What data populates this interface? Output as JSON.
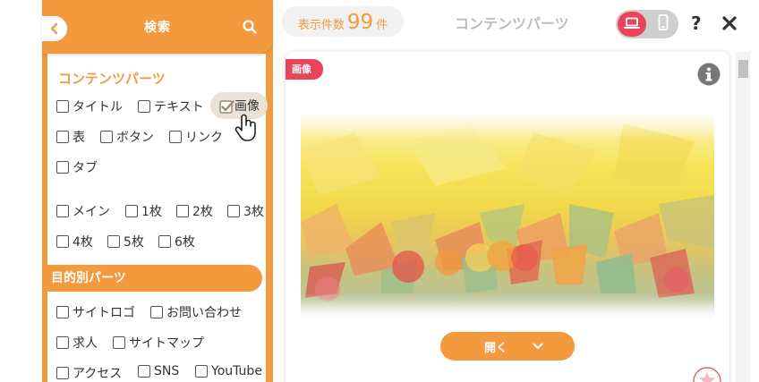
{
  "sidebar": {
    "title": "検索",
    "section1_title": "コンテンツパーツ",
    "section2_title": "目的別パーツ",
    "checkboxes": {
      "title": "タイトル",
      "text": "テキスト",
      "image": "画像",
      "table": "表",
      "button": "ボタン",
      "link": "リンク",
      "tab": "タブ",
      "main": "メイン",
      "one": "1枚",
      "two": "2枚",
      "three": "3枚",
      "four": "4枚",
      "five": "5枚",
      "six": "6枚",
      "sitelogo": "サイトロゴ",
      "contact": "お問い合わせ",
      "recruit": "求人",
      "sitemap": "サイトマップ",
      "access": "アクセス",
      "sns": "SNS",
      "youtube": "YouTube"
    }
  },
  "topbar": {
    "count_label": "表示件数",
    "count": "99",
    "count_unit": "件",
    "title": "コンテンツパーツ",
    "help": "?"
  },
  "card": {
    "badge": "画像",
    "open_label": "開く"
  },
  "colors": {
    "accent": "#f39a3f",
    "badge": "#e8445a"
  }
}
